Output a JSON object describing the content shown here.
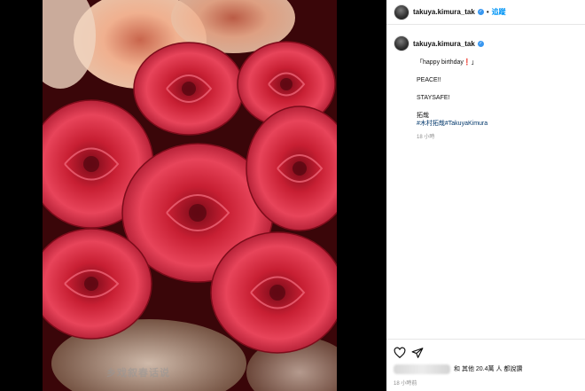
{
  "post": {
    "username": "takuya.kimura_tak",
    "follow_label": "追蹤",
    "separator": "•",
    "caption_lines": [
      "「happy birthday❗」",
      "PEACE!!",
      "STAYSAFE!",
      "拓哉"
    ],
    "hashtags": "#木村拓哉#TakuyaKimura",
    "caption_time": "18 小時",
    "likes_text": "和 其他 20.4萬 人 都說讚",
    "posted_time": "18 小時前"
  },
  "watermark": "乡戏叙春话说",
  "colors": {
    "accent": "#0095f6",
    "verified": "#3897f0",
    "hashtag": "#00376b",
    "muted": "#8e8e8e"
  },
  "icons": [
    "heart-icon",
    "send-icon",
    "verified-icon"
  ]
}
